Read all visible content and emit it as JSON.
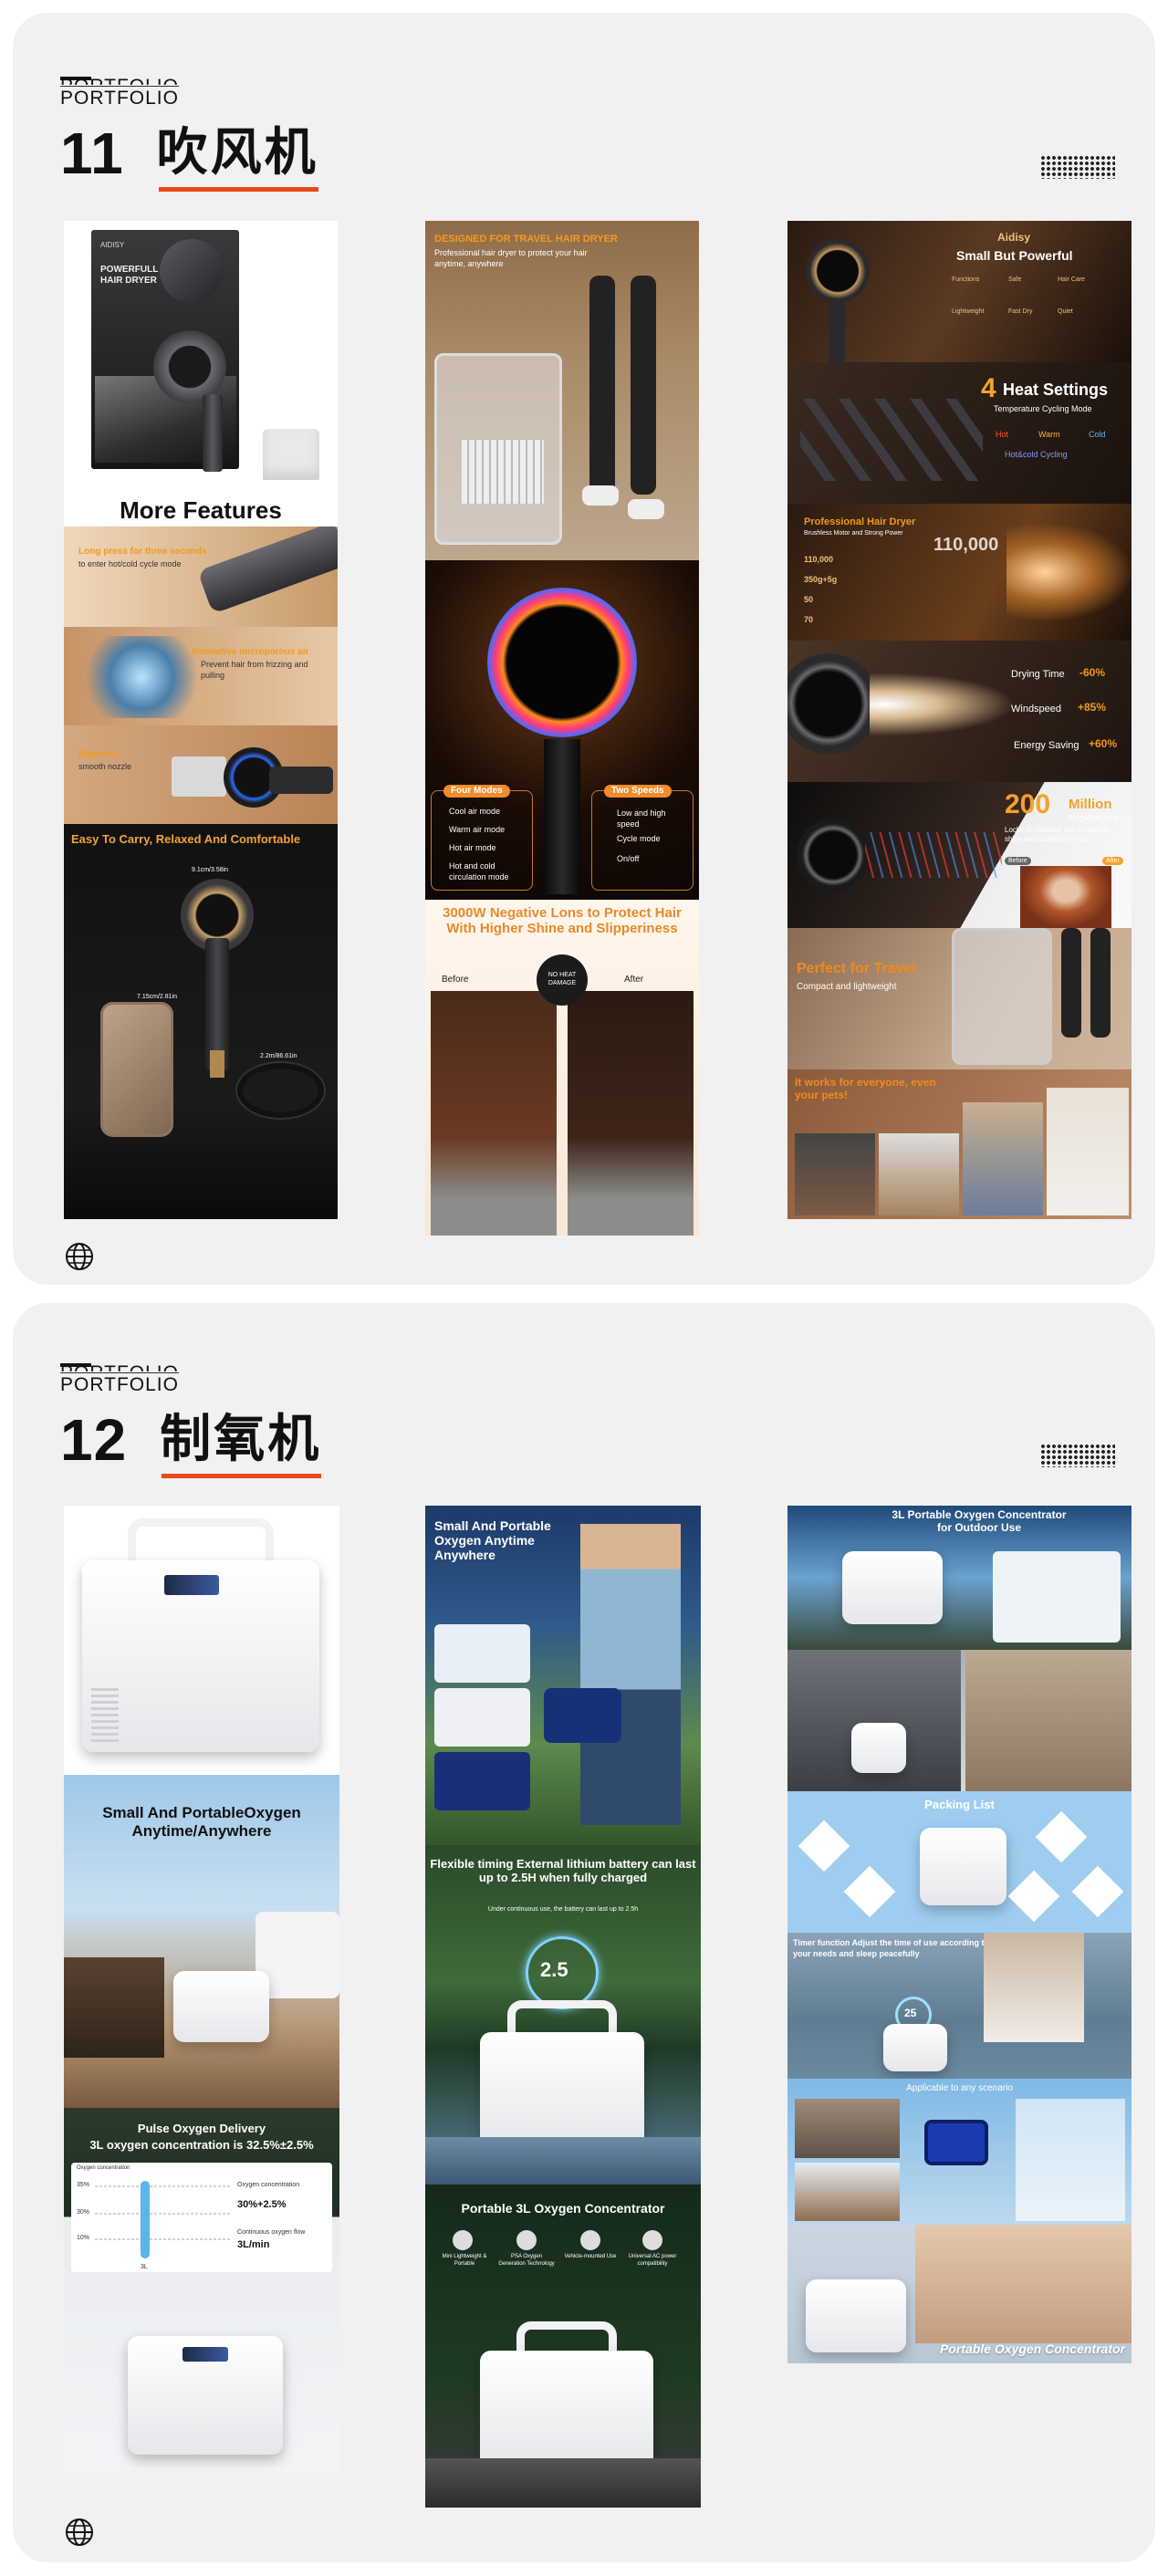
{
  "sections": [
    {
      "portfolio_label": "PORTFOLIO",
      "number": "11",
      "title": "吹风机",
      "panels": {
        "left": {
          "box_brand": "AIDISY",
          "box_title_1": "POWERFULL",
          "box_title_2": "HAIR DRYER",
          "more_features": "More Features",
          "feature_1": "Long press for three seconds",
          "feature_1_sub": "to enter hot/cold cycle mode",
          "feature_2": "Innovative microporous air",
          "feature_2_sub": "Prevent hair from frizzing and pulling",
          "feature_3": "Magnetic",
          "feature_3_sub": "smooth nozzle",
          "carry": "Easy To Carry, Relaxed And Comfortable",
          "dim_1": "9.1cm/3.58in",
          "dim_2": "7.15cm/2.81in",
          "dim_3": "2.2m/86.61in"
        },
        "middle": {
          "travel_title": "DESIGNED FOR TRAVEL HAIR DRYER",
          "travel_sub": "Professional hair dryer to protect your hair anytime, anywhere",
          "four_modes": "Four Modes",
          "two_speeds": "Two Speeds",
          "modes": [
            "Cool air mode",
            "Warm air mode",
            "Hot air mode",
            "Hot and cold circulation mode"
          ],
          "speeds": [
            "Low and high speed",
            "Cycle mode",
            "On/off"
          ],
          "negative_ions": "3000W Negative Lons to Protect Hair With Higher Shine and Slipperiness",
          "before": "Before",
          "after": "After",
          "badge": "NO HEAT DAMAGE"
        },
        "right": {
          "brand": "Aidisy",
          "tagline": "Small But Powerful",
          "icons": [
            "Functions",
            "Safe",
            "Hair Care",
            "Lightweight",
            "Fast Dry",
            "Quiet"
          ],
          "heat_num": "4",
          "heat_title": "Heat Settings",
          "heat_sub": "Temperature Cycling Mode",
          "heat_modes": [
            "Hot",
            "Warm",
            "Cold",
            "Hot&cold Cycling"
          ],
          "pro_title": "Professional Hair Dryer",
          "pro_sub": "Brushless Motor and Strong Power",
          "specs": [
            "110,000",
            "350g+5g",
            "50",
            "70"
          ],
          "spec_big": "110,000",
          "drying_label": "Drying Time",
          "drying_value": "-60%",
          "windspeed_label": "Windspeed",
          "windspeed_value": "+85%",
          "energy_label": "Energy Saving",
          "energy_value": "+60%",
          "million_num": "200",
          "million_word": "Million",
          "million_sub": "Negative ions",
          "million_desc": "Locks in moisture and enhances shine and softness of hair",
          "before": "Before",
          "after": "After",
          "travel_title": "Perfect for Travel",
          "travel_sub": "Compact and lightweight",
          "everyone_title": "It works for everyone, even your pets!"
        }
      }
    },
    {
      "portfolio_label": "PORTFOLIO",
      "number": "12",
      "title": "制氧机",
      "panels": {
        "left": {
          "small_portable": "Small And PortableOxygen Anytime/Anywhere",
          "pulse_title": "Pulse Oxygen Delivery",
          "pulse_sub": "3L oxygen concentration is 32.5%±2.5%",
          "chart_label": "Oxygen concentration",
          "chart_ticks": [
            "35%",
            "30%",
            "10%"
          ],
          "chart_x": "3L",
          "legend_1": "Oxygen concentration",
          "legend_1_value": "30%+2.5%",
          "legend_2": "Continuous oxygen flow",
          "legend_2_value": "3L/min"
        },
        "middle": {
          "hero_title": "Small And Portable Oxygen Anytime Anywhere",
          "battery_title": "Flexible timing External lithium battery can last up to 2.5H when fully charged",
          "battery_sub": "Under continuous use, the battery can last up to 2.5h",
          "battery_display": "2.5",
          "concentrator_title": "Portable 3L Oxygen Concentrator",
          "features": [
            "Mini Lightweight & Portable",
            "PSA Oxygen Generation Technology",
            "Vehicle-mounted Use",
            "Universal AC power compatibility"
          ]
        },
        "right": {
          "outdoor_title": "3L Portable Oxygen Concentrator for Outdoor Use",
          "packing_title": "Packing List",
          "sleep_title": "Timer function Adjust the time of use according to your needs and sleep peacefully",
          "sleep_display": "25",
          "scenario_title": "Applicable to any scenario",
          "bottom_title": "Portable Oxygen Concentrator"
        }
      }
    }
  ],
  "colors": {
    "accent_orange": "#e84a1b",
    "card_bg": "#f1f1f2",
    "text": "#111111"
  }
}
